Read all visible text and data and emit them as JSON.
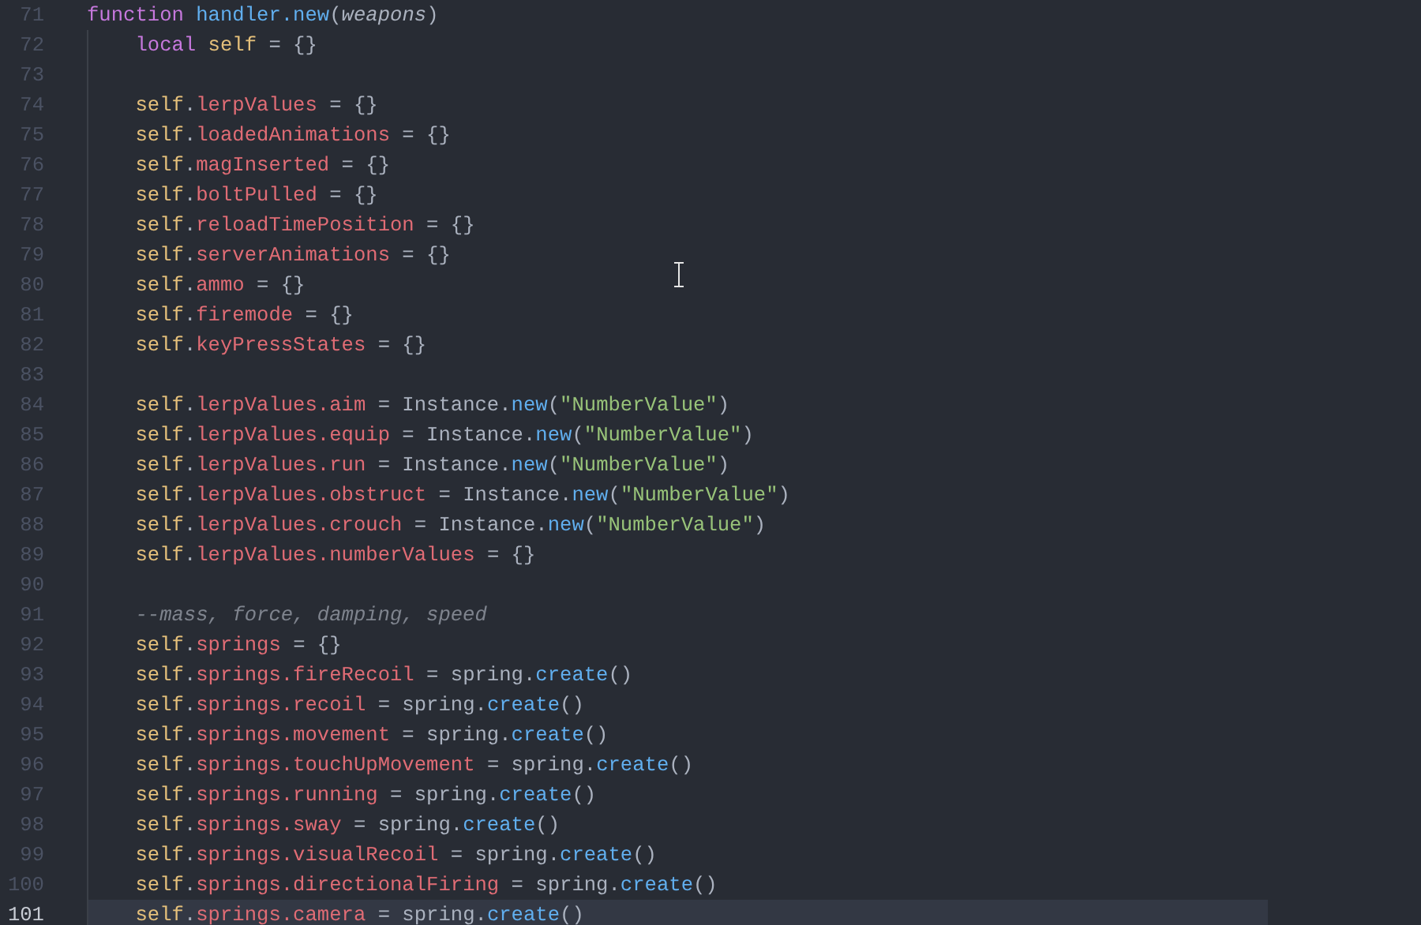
{
  "editor": {
    "lines": [
      {
        "number": "71",
        "current": false,
        "tokens": [
          {
            "text": "function ",
            "kind": "keyword"
          },
          {
            "text": "handler.new",
            "kind": "func"
          },
          {
            "text": "(",
            "kind": "punct"
          },
          {
            "text": "weapons",
            "kind": "param"
          },
          {
            "text": ")",
            "kind": "punct"
          }
        ],
        "children": [
          {
            "number": "72",
            "current": false,
            "tokens": [
              {
                "text": "local ",
                "kind": "keyword"
              },
              {
                "text": "self",
                "kind": "self"
              },
              {
                "text": " = {}",
                "kind": "punct"
              }
            ]
          },
          {
            "number": "73",
            "current": false
          },
          {
            "number": "74",
            "current": false,
            "tokens": [
              {
                "text": "self",
                "kind": "self"
              },
              {
                "text": ".",
                "kind": "punct"
              },
              {
                "text": "lerpValues",
                "kind": "prop"
              },
              {
                "text": " = {}",
                "kind": "punct"
              }
            ]
          },
          {
            "number": "75",
            "current": false,
            "tokens": [
              {
                "text": "self",
                "kind": "self"
              },
              {
                "text": ".",
                "kind": "punct"
              },
              {
                "text": "loadedAnimations",
                "kind": "prop"
              },
              {
                "text": " = {}",
                "kind": "punct"
              }
            ]
          },
          {
            "number": "76",
            "current": false,
            "tokens": [
              {
                "text": "self",
                "kind": "self"
              },
              {
                "text": ".",
                "kind": "punct"
              },
              {
                "text": "magInserted",
                "kind": "prop"
              },
              {
                "text": " = {}",
                "kind": "punct"
              }
            ]
          },
          {
            "number": "77",
            "current": false,
            "tokens": [
              {
                "text": "self",
                "kind": "self"
              },
              {
                "text": ".",
                "kind": "punct"
              },
              {
                "text": "boltPulled",
                "kind": "prop"
              },
              {
                "text": " = {}",
                "kind": "punct"
              }
            ]
          },
          {
            "number": "78",
            "current": false,
            "tokens": [
              {
                "text": "self",
                "kind": "self"
              },
              {
                "text": ".",
                "kind": "punct"
              },
              {
                "text": "reloadTimePosition",
                "kind": "prop"
              },
              {
                "text": " = {}",
                "kind": "punct"
              }
            ]
          },
          {
            "number": "79",
            "current": false,
            "tokens": [
              {
                "text": "self",
                "kind": "self"
              },
              {
                "text": ".",
                "kind": "punct"
              },
              {
                "text": "serverAnimations",
                "kind": "prop"
              },
              {
                "text": " = {}",
                "kind": "punct"
              }
            ]
          },
          {
            "number": "80",
            "current": false,
            "tokens": [
              {
                "text": "self",
                "kind": "self"
              },
              {
                "text": ".",
                "kind": "punct"
              },
              {
                "text": "ammo",
                "kind": "prop"
              },
              {
                "text": " = {}",
                "kind": "punct"
              }
            ]
          },
          {
            "number": "81",
            "current": false,
            "tokens": [
              {
                "text": "self",
                "kind": "self"
              },
              {
                "text": ".",
                "kind": "punct"
              },
              {
                "text": "firemode",
                "kind": "prop"
              },
              {
                "text": " = {}",
                "kind": "punct"
              }
            ]
          },
          {
            "number": "82",
            "current": false,
            "tokens": [
              {
                "text": "self",
                "kind": "self"
              },
              {
                "text": ".",
                "kind": "punct"
              },
              {
                "text": "keyPressStates",
                "kind": "prop"
              },
              {
                "text": " = {}",
                "kind": "punct"
              }
            ]
          },
          {
            "number": "83",
            "current": false
          },
          {
            "number": "84",
            "current": false,
            "tokens": [
              {
                "text": "self",
                "kind": "self"
              },
              {
                "text": ".",
                "kind": "punct"
              },
              {
                "text": "lerpValues.aim",
                "kind": "prop"
              },
              {
                "text": " = Instance.",
                "kind": "punct"
              },
              {
                "text": "new",
                "kind": "func"
              },
              {
                "text": "(",
                "kind": "punct"
              },
              {
                "text": "\"NumberValue\"",
                "kind": "string"
              },
              {
                "text": ")",
                "kind": "punct"
              }
            ]
          },
          {
            "number": "85",
            "current": false,
            "tokens": [
              {
                "text": "self",
                "kind": "self"
              },
              {
                "text": ".",
                "kind": "punct"
              },
              {
                "text": "lerpValues.equip",
                "kind": "prop"
              },
              {
                "text": " = Instance.",
                "kind": "punct"
              },
              {
                "text": "new",
                "kind": "func"
              },
              {
                "text": "(",
                "kind": "punct"
              },
              {
                "text": "\"NumberValue\"",
                "kind": "string"
              },
              {
                "text": ")",
                "kind": "punct"
              }
            ]
          },
          {
            "number": "86",
            "current": false,
            "tokens": [
              {
                "text": "self",
                "kind": "self"
              },
              {
                "text": ".",
                "kind": "punct"
              },
              {
                "text": "lerpValues.run",
                "kind": "prop"
              },
              {
                "text": " = Instance.",
                "kind": "punct"
              },
              {
                "text": "new",
                "kind": "func"
              },
              {
                "text": "(",
                "kind": "punct"
              },
              {
                "text": "\"NumberValue\"",
                "kind": "string"
              },
              {
                "text": ")",
                "kind": "punct"
              }
            ]
          },
          {
            "number": "87",
            "current": false,
            "tokens": [
              {
                "text": "self",
                "kind": "self"
              },
              {
                "text": ".",
                "kind": "punct"
              },
              {
                "text": "lerpValues.obstruct",
                "kind": "prop"
              },
              {
                "text": " = Instance.",
                "kind": "punct"
              },
              {
                "text": "new",
                "kind": "func"
              },
              {
                "text": "(",
                "kind": "punct"
              },
              {
                "text": "\"NumberValue\"",
                "kind": "string"
              },
              {
                "text": ")",
                "kind": "punct"
              }
            ]
          },
          {
            "number": "88",
            "current": false,
            "tokens": [
              {
                "text": "self",
                "kind": "self"
              },
              {
                "text": ".",
                "kind": "punct"
              },
              {
                "text": "lerpValues.crouch",
                "kind": "prop"
              },
              {
                "text": " = Instance.",
                "kind": "punct"
              },
              {
                "text": "new",
                "kind": "func"
              },
              {
                "text": "(",
                "kind": "punct"
              },
              {
                "text": "\"NumberValue\"",
                "kind": "string"
              },
              {
                "text": ")",
                "kind": "punct"
              }
            ]
          },
          {
            "number": "89",
            "current": false,
            "tokens": [
              {
                "text": "self",
                "kind": "self"
              },
              {
                "text": ".",
                "kind": "punct"
              },
              {
                "text": "lerpValues.numberValues",
                "kind": "prop"
              },
              {
                "text": " = {}",
                "kind": "punct"
              }
            ]
          },
          {
            "number": "90",
            "current": false
          },
          {
            "number": "91",
            "current": false,
            "tokens": [
              {
                "text": "--mass, force, damping, speed",
                "kind": "comment"
              }
            ]
          },
          {
            "number": "92",
            "current": false,
            "tokens": [
              {
                "text": "self",
                "kind": "self"
              },
              {
                "text": ".",
                "kind": "punct"
              },
              {
                "text": "springs",
                "kind": "prop"
              },
              {
                "text": " = {}",
                "kind": "punct"
              }
            ]
          },
          {
            "number": "93",
            "current": false,
            "tokens": [
              {
                "text": "self",
                "kind": "self"
              },
              {
                "text": ".",
                "kind": "punct"
              },
              {
                "text": "springs.fireRecoil",
                "kind": "prop"
              },
              {
                "text": " = spring.",
                "kind": "punct"
              },
              {
                "text": "create",
                "kind": "func"
              },
              {
                "text": "()",
                "kind": "punct"
              }
            ]
          },
          {
            "number": "94",
            "current": false,
            "tokens": [
              {
                "text": "self",
                "kind": "self"
              },
              {
                "text": ".",
                "kind": "punct"
              },
              {
                "text": "springs.recoil",
                "kind": "prop"
              },
              {
                "text": " = spring.",
                "kind": "punct"
              },
              {
                "text": "create",
                "kind": "func"
              },
              {
                "text": "()",
                "kind": "punct"
              }
            ]
          },
          {
            "number": "95",
            "current": false,
            "tokens": [
              {
                "text": "self",
                "kind": "self"
              },
              {
                "text": ".",
                "kind": "punct"
              },
              {
                "text": "springs.movement",
                "kind": "prop"
              },
              {
                "text": " = spring.",
                "kind": "punct"
              },
              {
                "text": "create",
                "kind": "func"
              },
              {
                "text": "()",
                "kind": "punct"
              }
            ]
          },
          {
            "number": "96",
            "current": false,
            "tokens": [
              {
                "text": "self",
                "kind": "self"
              },
              {
                "text": ".",
                "kind": "punct"
              },
              {
                "text": "springs.touchUpMovement",
                "kind": "prop"
              },
              {
                "text": " = spring.",
                "kind": "punct"
              },
              {
                "text": "create",
                "kind": "func"
              },
              {
                "text": "()",
                "kind": "punct"
              }
            ]
          },
          {
            "number": "97",
            "current": false,
            "tokens": [
              {
                "text": "self",
                "kind": "self"
              },
              {
                "text": ".",
                "kind": "punct"
              },
              {
                "text": "springs.running",
                "kind": "prop"
              },
              {
                "text": " = spring.",
                "kind": "punct"
              },
              {
                "text": "create",
                "kind": "func"
              },
              {
                "text": "()",
                "kind": "punct"
              }
            ]
          },
          {
            "number": "98",
            "current": false,
            "tokens": [
              {
                "text": "self",
                "kind": "self"
              },
              {
                "text": ".",
                "kind": "punct"
              },
              {
                "text": "springs.sway",
                "kind": "prop"
              },
              {
                "text": " = spring.",
                "kind": "punct"
              },
              {
                "text": "create",
                "kind": "func"
              },
              {
                "text": "()",
                "kind": "punct"
              }
            ]
          },
          {
            "number": "99",
            "current": false,
            "tokens": [
              {
                "text": "self",
                "kind": "self"
              },
              {
                "text": ".",
                "kind": "punct"
              },
              {
                "text": "springs.visualRecoil",
                "kind": "prop"
              },
              {
                "text": " = spring.",
                "kind": "punct"
              },
              {
                "text": "create",
                "kind": "func"
              },
              {
                "text": "()",
                "kind": "punct"
              }
            ]
          },
          {
            "number": "100",
            "current": false,
            "tokens": [
              {
                "text": "self",
                "kind": "self"
              },
              {
                "text": ".",
                "kind": "punct"
              },
              {
                "text": "springs.directionalFiring",
                "kind": "prop"
              },
              {
                "text": " = spring.",
                "kind": "punct"
              },
              {
                "text": "create",
                "kind": "func"
              },
              {
                "text": "()",
                "kind": "punct"
              }
            ]
          },
          {
            "number": "101",
            "current": true,
            "tokens": [
              {
                "text": "self",
                "kind": "self"
              },
              {
                "text": ".",
                "kind": "punct"
              },
              {
                "text": "springs.camera",
                "kind": "prop"
              },
              {
                "text": " = spring.",
                "kind": "punct"
              },
              {
                "text": "create",
                "kind": "func"
              },
              {
                "text": "()",
                "kind": "punct"
              }
            ]
          }
        ]
      }
    ]
  }
}
